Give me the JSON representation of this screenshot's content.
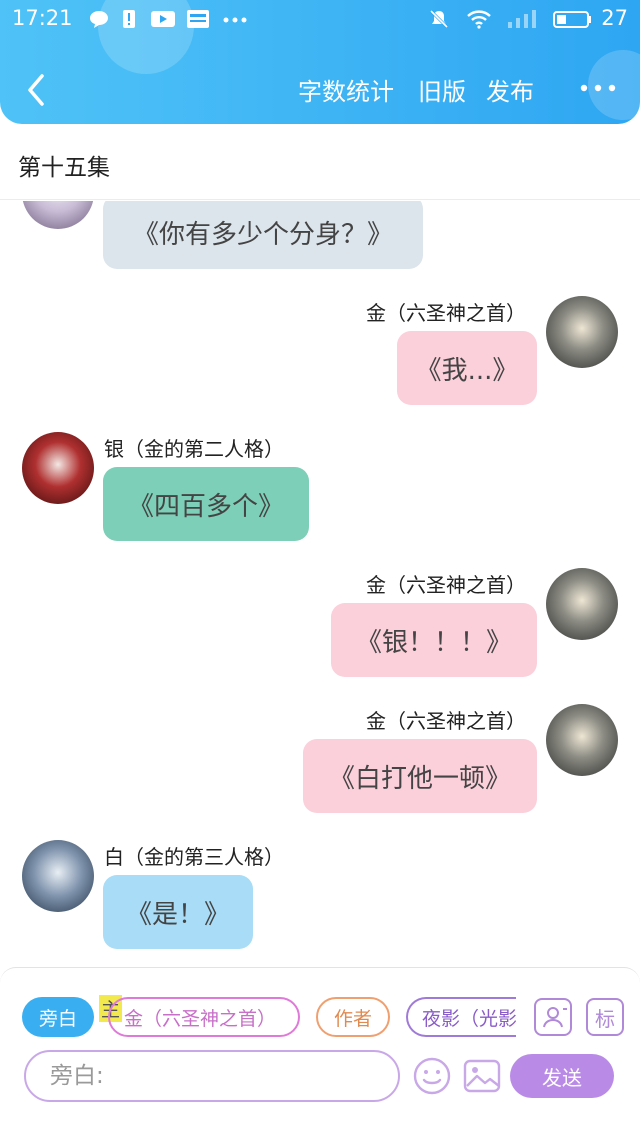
{
  "status_bar": {
    "time": "17:21",
    "battery": "27",
    "icons": [
      "chat-bubble-icon",
      "alert-icon",
      "video-icon",
      "news-icon",
      "more-dots-icon",
      "mute-icon",
      "wifi-icon",
      "signal-icon",
      "battery-icon"
    ]
  },
  "nav": {
    "back_icon": "chevron-left-icon",
    "word_count": "字数统计",
    "old_version": "旧版",
    "publish": "发布",
    "more_icon": "more-dots-icon"
  },
  "episode_title": "第十五集",
  "messages": [
    {
      "side": "left",
      "speaker": "",
      "text": "《你有多少个分身？》",
      "color": "#dce4ec",
      "avatar": "avatar-white-hair-icon"
    },
    {
      "side": "right",
      "speaker": "金（六圣神之首）",
      "text": "《我...》",
      "color": "#fbd0da",
      "avatar": "avatar-gold-icon"
    },
    {
      "side": "left",
      "speaker": "银（金的第二人格）",
      "text": "《四百多个》",
      "color": "#7ecfb7",
      "avatar": "avatar-silver-icon"
    },
    {
      "side": "right",
      "speaker": "金（六圣神之首）",
      "text": "《银！！！》",
      "color": "#fbd0da",
      "avatar": "avatar-gold-icon"
    },
    {
      "side": "right",
      "speaker": "金（六圣神之首）",
      "text": "《白打他一顿》",
      "color": "#fbd0da",
      "avatar": "avatar-gold-icon"
    },
    {
      "side": "left",
      "speaker": "白（金的第三人格）",
      "text": "《是！》",
      "color": "#a9dcf6",
      "avatar": "avatar-bai-icon"
    }
  ],
  "composer": {
    "chips": {
      "narration": "旁白",
      "main_tag": "主",
      "gold": "金（六圣神之首）",
      "author": "作者",
      "yeying": "夜影（光影"
    },
    "role_icon": "person-card-icon",
    "tag_label": "标",
    "input_placeholder": "旁白:",
    "emoji_icon": "smiley-icon",
    "image_icon": "image-icon",
    "send": "发送"
  },
  "colors": {
    "header": "#2ea6f2",
    "accent_purple": "#b98be6",
    "narration_chip": "#39aef0",
    "gold_chip_border": "#e07ad8",
    "author_chip_border": "#f0a070",
    "yeying_chip_border": "#a07ad8"
  }
}
